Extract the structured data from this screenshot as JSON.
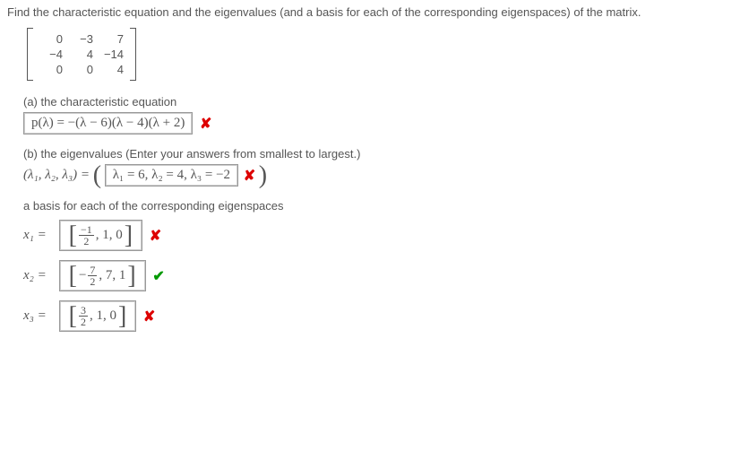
{
  "prompt": "Find the characteristic equation and the eigenvalues (and a basis for each of the corresponding eigenspaces) of the matrix.",
  "matrix": {
    "rows": [
      [
        "0",
        "−3",
        "7"
      ],
      [
        "−4",
        "4",
        "−14"
      ],
      [
        "0",
        "0",
        "4"
      ]
    ]
  },
  "part_a": {
    "label": "(a) the characteristic equation",
    "answer": "p(λ) = −(λ − 6)(λ − 4)(λ + 2)",
    "mark": "✘"
  },
  "part_b": {
    "label": "(b) the eigenvalues (Enter your answers from smallest to largest.)",
    "lhs": "(λ₁, λ₂, λ₃) = ",
    "answer": "λ₁ = 6, λ₂ = 4, λ₃ = −2",
    "mark": "✘"
  },
  "basis_label": "a basis for each of the corresponding eigenspaces",
  "x1": {
    "label": "x₁ =",
    "frac_num": "−1",
    "frac_den": "2",
    "rest": ", 1, 0",
    "mark": "✘"
  },
  "x2": {
    "label": "x₂ =",
    "minus": "−",
    "frac_num": "7",
    "frac_den": "2",
    "rest": ", 7, 1",
    "mark": "✔"
  },
  "x3": {
    "label": "x₃ =",
    "frac_num": "3",
    "frac_den": "2",
    "rest": ", 1, 0",
    "mark": "✘"
  }
}
